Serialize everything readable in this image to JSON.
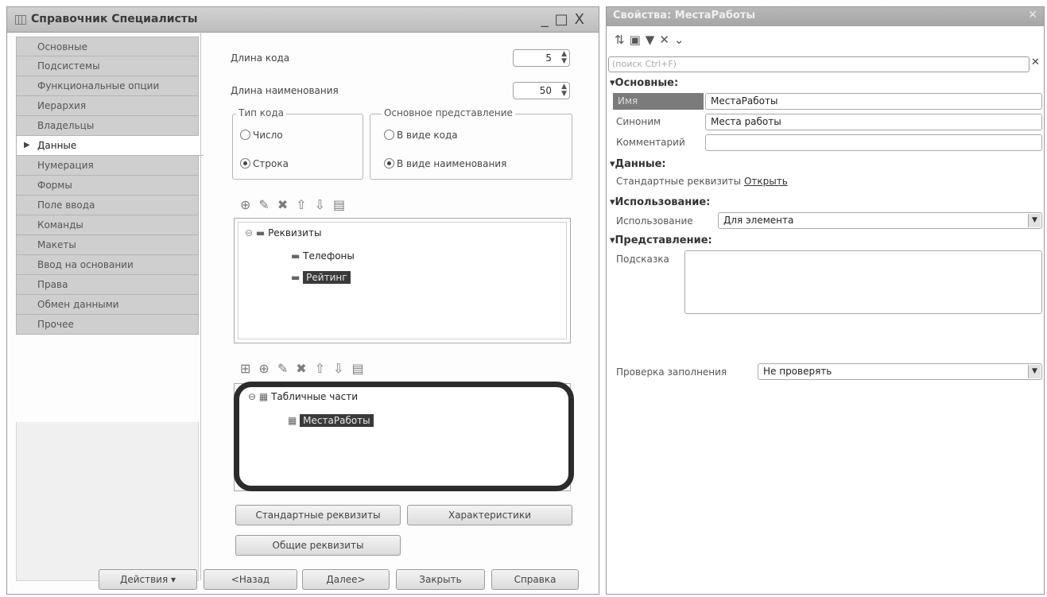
{
  "left_window": {
    "title": "Справочник Специалисты",
    "controls": {
      "minimize": "_",
      "maximize": "□",
      "close": "X"
    }
  },
  "tabs": [
    {
      "label": "Основные"
    },
    {
      "label": "Подсистемы"
    },
    {
      "label": "Функциональные опции"
    },
    {
      "label": "Иерархия"
    },
    {
      "label": "Владельцы"
    },
    {
      "label": "Данные",
      "active": true
    },
    {
      "label": "Нумерация"
    },
    {
      "label": "Формы"
    },
    {
      "label": "Поле ввода"
    },
    {
      "label": "Команды"
    },
    {
      "label": "Макеты"
    },
    {
      "label": "Ввод на основании"
    },
    {
      "label": "Права"
    },
    {
      "label": "Обмен данными"
    },
    {
      "label": "Прочее"
    }
  ],
  "data_panel": {
    "code_length_label": "Длина кода",
    "code_length_value": "5",
    "name_length_label": "Длина наименования",
    "name_length_value": "50",
    "code_type": {
      "title": "Тип кода",
      "options": [
        "Число",
        "Строка"
      ],
      "selected": "Строка"
    },
    "main_representation": {
      "title": "Основное представление",
      "options": [
        "В виде кода",
        "В виде наименования"
      ],
      "selected": "В виде наименования"
    },
    "attributes_tree": {
      "root": "Реквизиты",
      "items": [
        "Телефоны",
        "Рейтинг"
      ],
      "selected": "Рейтинг"
    },
    "tabular_tree": {
      "root": "Табличные части",
      "items": [
        "МестаРаботы"
      ],
      "selected": "МестаРаботы"
    },
    "buttons": {
      "standard_attributes": "Стандартные реквизиты",
      "characteristics": "Характеристики",
      "common_attributes": "Общие реквизиты"
    }
  },
  "footer": {
    "actions": "Действия",
    "back": "<Назад",
    "next": "Далее>",
    "close": "Закрыть",
    "help": "Справка"
  },
  "properties": {
    "title": "Свойства: МестаРаботы",
    "search_placeholder": "(поиск Ctrl+F)",
    "sections": {
      "basic": "Основные:",
      "data": "Данные:",
      "usage": "Использование:",
      "presentation": "Представление:"
    },
    "name_label": "Имя",
    "name_value": "МестаРаботы",
    "synonym_label": "Синоним",
    "synonym_value": "Места работы",
    "comment_label": "Комментарий",
    "comment_value": "",
    "std_attr_label": "Стандартные реквизиты",
    "std_attr_link": "Открыть",
    "usage_label": "Использование",
    "usage_value": "Для элемента",
    "tooltip_label": "Подсказка",
    "fill_check_label": "Проверка заполнения",
    "fill_check_value": "Не проверять"
  }
}
